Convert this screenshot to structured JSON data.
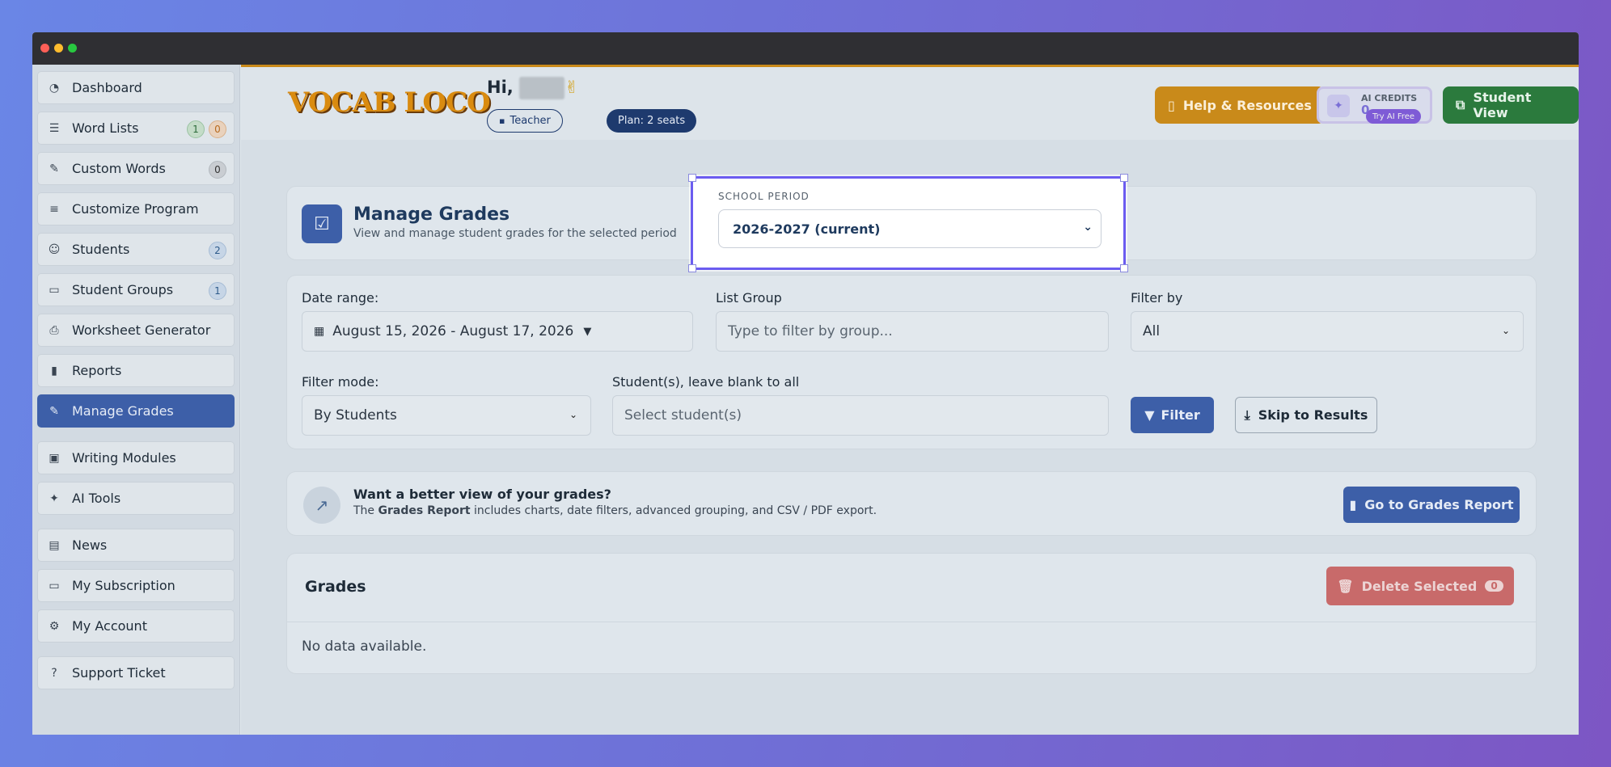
{
  "colors": {
    "accent": "#3d5fa8",
    "help": "#c98a1a",
    "student_view": "#2b7a3d",
    "delete": "#c86a6a",
    "highlight": "#6b5cf0"
  },
  "sidebar": {
    "items": [
      {
        "label": "Dashboard",
        "icon": "gauge-icon"
      },
      {
        "label": "Word Lists",
        "icon": "list-icon",
        "badges": [
          "1",
          "0"
        ]
      },
      {
        "label": "Custom Words",
        "icon": "edit-icon",
        "badges": [
          "0"
        ]
      },
      {
        "label": "Customize Program",
        "icon": "sliders-icon"
      },
      {
        "label": "Students",
        "icon": "users-icon",
        "badges": [
          "2"
        ]
      },
      {
        "label": "Student Groups",
        "icon": "folder-icon",
        "badges": [
          "1"
        ]
      },
      {
        "label": "Worksheet Generator",
        "icon": "printer-icon"
      },
      {
        "label": "Reports",
        "icon": "bar-chart-icon"
      },
      {
        "label": "Manage Grades",
        "icon": "edit-icon"
      },
      {
        "label": "Writing Modules",
        "icon": "terminal-icon"
      },
      {
        "label": "AI Tools",
        "icon": "sparkles-icon"
      },
      {
        "label": "News",
        "icon": "newspaper-icon"
      },
      {
        "label": "My Subscription",
        "icon": "card-icon"
      },
      {
        "label": "My Account",
        "icon": "gear-icon"
      },
      {
        "label": "Support Ticket",
        "icon": "question-icon"
      }
    ]
  },
  "header": {
    "logo": "VOCAB LOCO",
    "greeting": "Hi,",
    "wave": "✌",
    "role": "Teacher",
    "plan": "Plan: 2 seats",
    "help": "Help & Resources",
    "ai_credits_label": "AI CREDITS",
    "ai_credits_value": "0",
    "try_ai": "Try AI Free",
    "student_view": "Student View"
  },
  "page": {
    "title": "Manage Grades",
    "subtitle": "View and manage student grades for the selected period"
  },
  "period": {
    "label": "SCHOOL PERIOD",
    "value": "2026-2027 (current)"
  },
  "filters": {
    "date_range_label": "Date range:",
    "date_range_value": "August 15, 2026 - August 17, 2026",
    "list_group_label": "List Group",
    "list_group_placeholder": "Type to filter by group...",
    "filter_by_label": "Filter by",
    "filter_by_value": "All",
    "filter_mode_label": "Filter mode:",
    "filter_mode_value": "By Students",
    "students_label": "Student(s), leave blank to all",
    "students_placeholder": "Select student(s)",
    "filter_button": "Filter",
    "skip_button": "Skip to Results"
  },
  "promo": {
    "title": "Want a better view of your grades?",
    "text_pre": "The ",
    "text_bold": "Grades Report",
    "text_post": " includes charts, date filters, advanced grouping, and CSV / PDF export.",
    "button": "Go to Grades Report"
  },
  "grades": {
    "title": "Grades",
    "delete_label": "Delete Selected",
    "delete_count": "0",
    "empty": "No data available."
  }
}
